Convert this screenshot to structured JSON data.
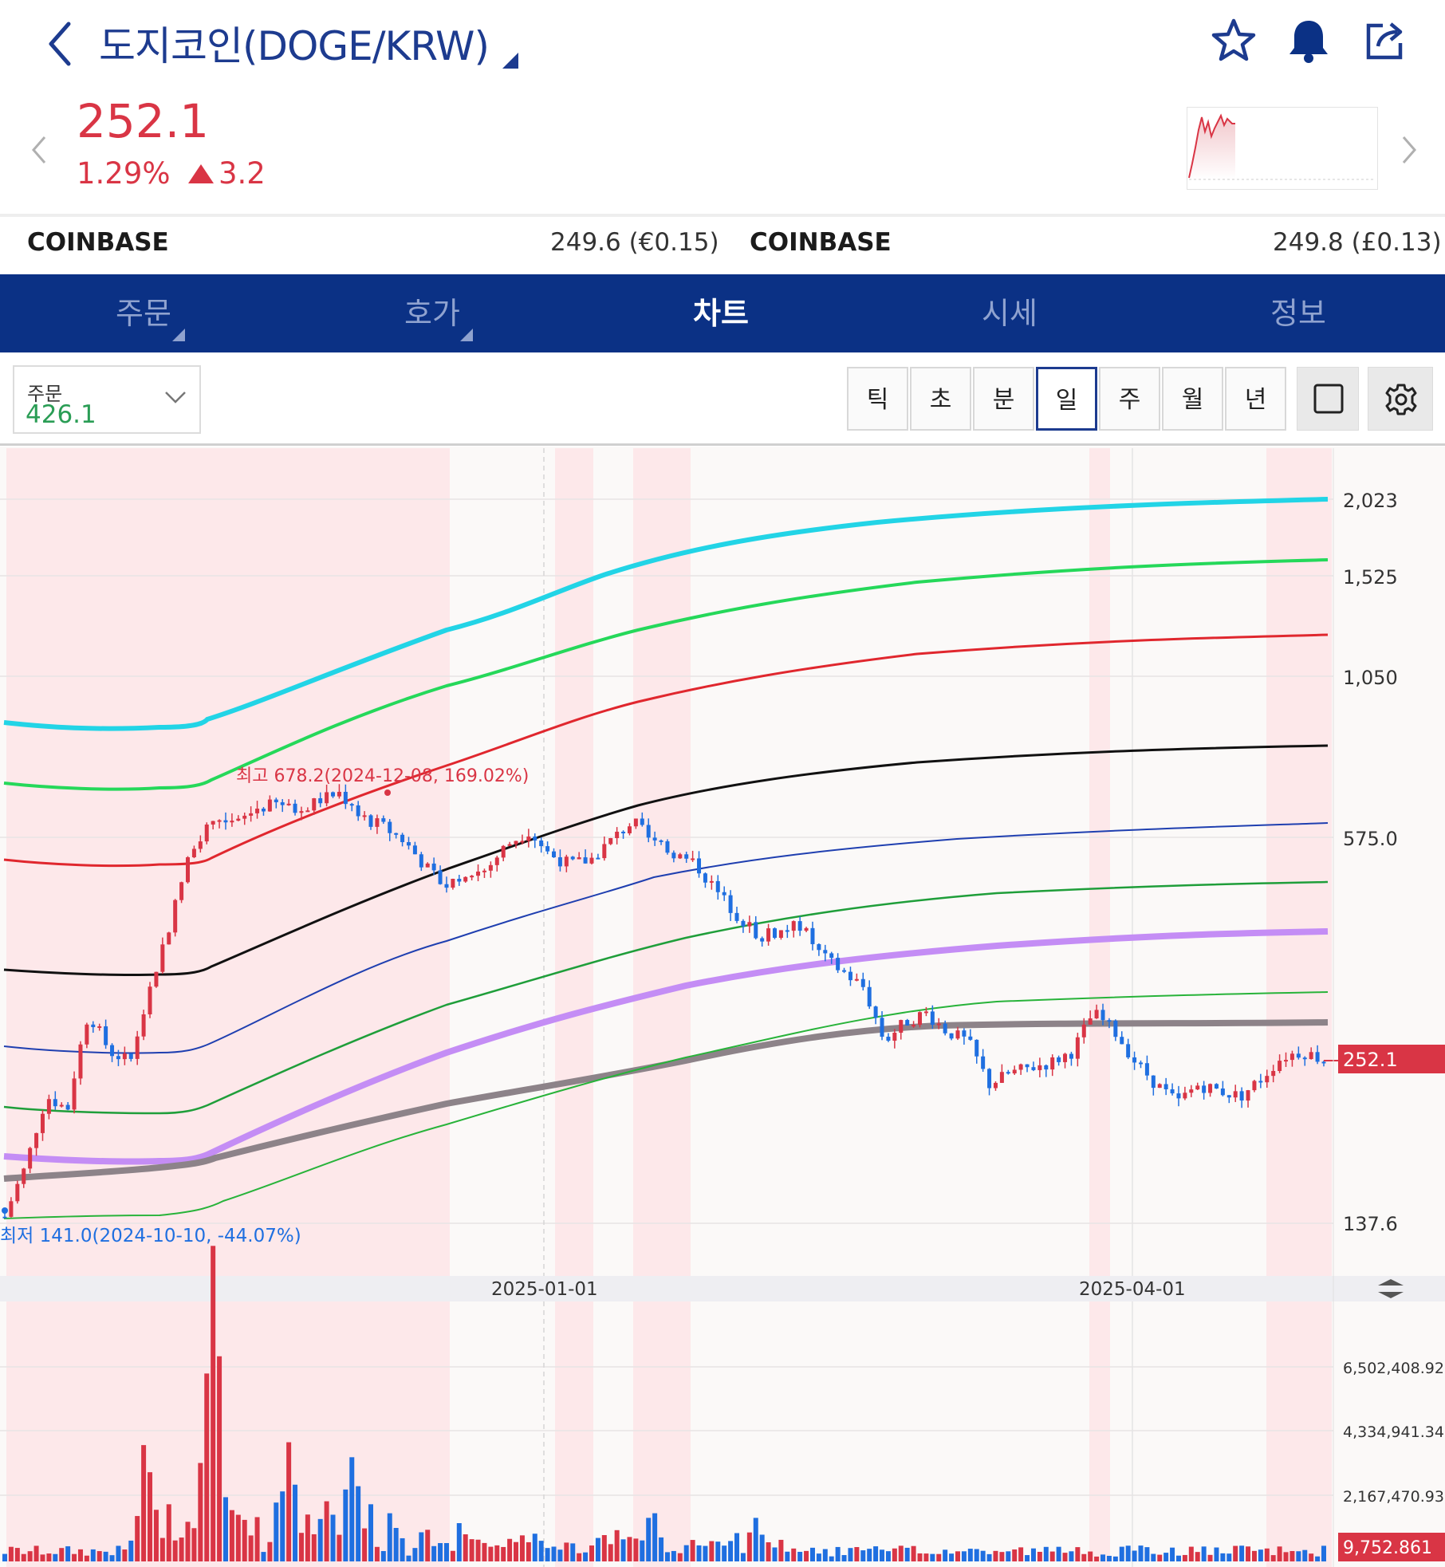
{
  "header": {
    "title": "도지코인(DOGE/KRW)",
    "price": "252.1",
    "change_pct": "1.29%",
    "change_val": "3.2",
    "icons": [
      "chevron-left-icon",
      "star-icon",
      "bell-icon",
      "share-icon"
    ]
  },
  "exchanges": [
    {
      "name": "COINBASE",
      "value": "249.6 (€0.15)"
    },
    {
      "name": "COINBASE",
      "value": "249.8 (£0.13)"
    }
  ],
  "tabs": [
    {
      "label": "주문",
      "has_menu": true
    },
    {
      "label": "호가",
      "has_menu": true
    },
    {
      "label": "차트",
      "active": true
    },
    {
      "label": "시세"
    },
    {
      "label": "정보"
    }
  ],
  "order_dropdown": {
    "label": "주문",
    "value": "426.1"
  },
  "periods": [
    "틱",
    "초",
    "분",
    "일",
    "주",
    "월",
    "년"
  ],
  "active_period": "일",
  "colors": {
    "up": "#d93545",
    "down": "#1f6fe0",
    "nav": "#0b3185",
    "accent": "#1d3b8f"
  },
  "chart_data": {
    "type": "candlestick",
    "price_axis_ticks": [
      "2,023",
      "1,525",
      "1,050",
      "575.0",
      "137.6"
    ],
    "x_axis_ticks": [
      "2025-01-01",
      "2025-04-01"
    ],
    "current_price_label": "252.1",
    "annotations": {
      "high": "최고 678.2(2024-12-08, 169.02%)",
      "low": "최저 141.0(2024-10-10, -44.07%)"
    },
    "volume_axis_ticks": [
      "6,502,408.921",
      "4,334,941.348",
      "2,167,470.932"
    ],
    "current_volume_label": "9,752.861",
    "close_path": [
      141,
      170,
      220,
      210,
      300,
      260,
      250,
      330,
      430,
      560,
      620,
      600,
      640,
      650,
      630,
      660,
      678,
      620,
      600,
      570,
      520,
      480,
      500,
      510,
      560,
      590,
      540,
      520,
      530,
      570,
      610,
      560,
      540,
      520,
      470,
      430,
      400,
      405,
      415,
      370,
      350,
      330,
      270,
      290,
      300,
      280,
      270,
      230,
      240,
      245,
      250,
      260,
      300,
      280,
      250,
      230,
      215,
      230,
      225,
      220,
      235,
      255,
      260,
      252
    ]
  }
}
